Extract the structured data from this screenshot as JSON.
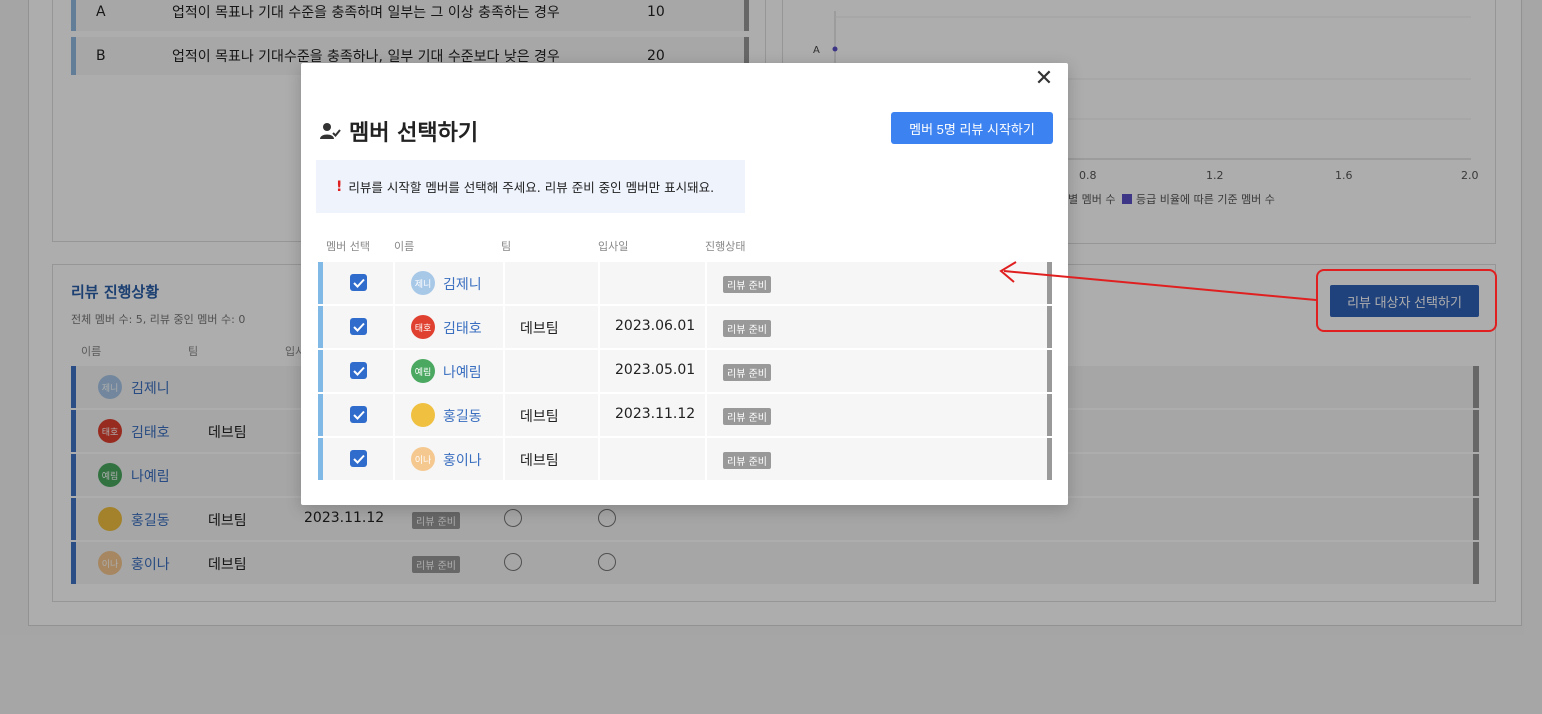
{
  "grade_table": {
    "rows": [
      {
        "grade": "A",
        "desc": "업적이 목표나 기대 수준을 충족하며 일부는 그 이상 충족하는 경우",
        "num": "10"
      },
      {
        "grade": "B",
        "desc": "업적이 목표나 기대수준을 충족하나, 일부 기대 수준보다 낮은 경우",
        "num": "20"
      }
    ]
  },
  "chart": {
    "y_label": "A",
    "ticks": [
      "0.8",
      "1.2",
      "1.6",
      "2.0"
    ],
    "legend_1": "별 멤버 수",
    "legend_2": "등급 비율에 따른 기준 멤버 수",
    "legend_2_color": "#5b4fc4"
  },
  "progress": {
    "title": "리뷰 진행상황",
    "subtitle": "전체 멤버 수: 5, 리뷰 중인 멤버 수: 0",
    "headers": {
      "name": "이름",
      "team": "팀",
      "date": "입사"
    },
    "select_button": "리뷰 대상자 선택하기",
    "rows": [
      {
        "avatar": "제니",
        "avatar_color": "#a8c8e8",
        "name": "김제니",
        "team": "",
        "date": "",
        "status": ""
      },
      {
        "avatar": "태호",
        "avatar_color": "#e04030",
        "name": "김태호",
        "team": "데브팀",
        "date": "",
        "status": ""
      },
      {
        "avatar": "예림",
        "avatar_color": "#4aa860",
        "name": "나예림",
        "team": "",
        "date": "",
        "status": ""
      },
      {
        "avatar": "",
        "avatar_color": "#f0c040",
        "name": "홍길동",
        "team": "데브팀",
        "date": "2023.11.12",
        "status": "리뷰 준비"
      },
      {
        "avatar": "이나",
        "avatar_color": "#f5c890",
        "name": "홍이나",
        "team": "데브팀",
        "date": "",
        "status": "리뷰 준비"
      }
    ]
  },
  "modal": {
    "title": "멤버 선택하기",
    "start_button": "멤버 5명 리뷰 시작하기",
    "notice_mark": "!",
    "notice": "리뷰를 시작할 멤버를 선택해 주세요. 리뷰 준비 중인 멤버만 표시돼요.",
    "headers": {
      "select": "멤버 선택",
      "name": "이름",
      "team": "팀",
      "date": "입사일",
      "status": "진행상태"
    },
    "rows": [
      {
        "avatar": "제니",
        "avatar_color": "#a8c8e8",
        "name": "김제니",
        "team": "",
        "date": "",
        "status": "리뷰 준비",
        "checked": true
      },
      {
        "avatar": "태호",
        "avatar_color": "#e04030",
        "name": "김태호",
        "team": "데브팀",
        "date": "2023.06.01",
        "status": "리뷰 준비",
        "checked": true
      },
      {
        "avatar": "예림",
        "avatar_color": "#4aa860",
        "name": "나예림",
        "team": "",
        "date": "2023.05.01",
        "status": "리뷰 준비",
        "checked": true
      },
      {
        "avatar": "",
        "avatar_color": "#f0c040",
        "name": "홍길동",
        "team": "데브팀",
        "date": "2023.11.12",
        "status": "리뷰 준비",
        "checked": true
      },
      {
        "avatar": "이나",
        "avatar_color": "#f5c890",
        "name": "홍이나",
        "team": "데브팀",
        "date": "",
        "status": "리뷰 준비",
        "checked": true
      }
    ]
  },
  "colors": {
    "accent": "#3c82f0",
    "annotation": "#e02020"
  }
}
